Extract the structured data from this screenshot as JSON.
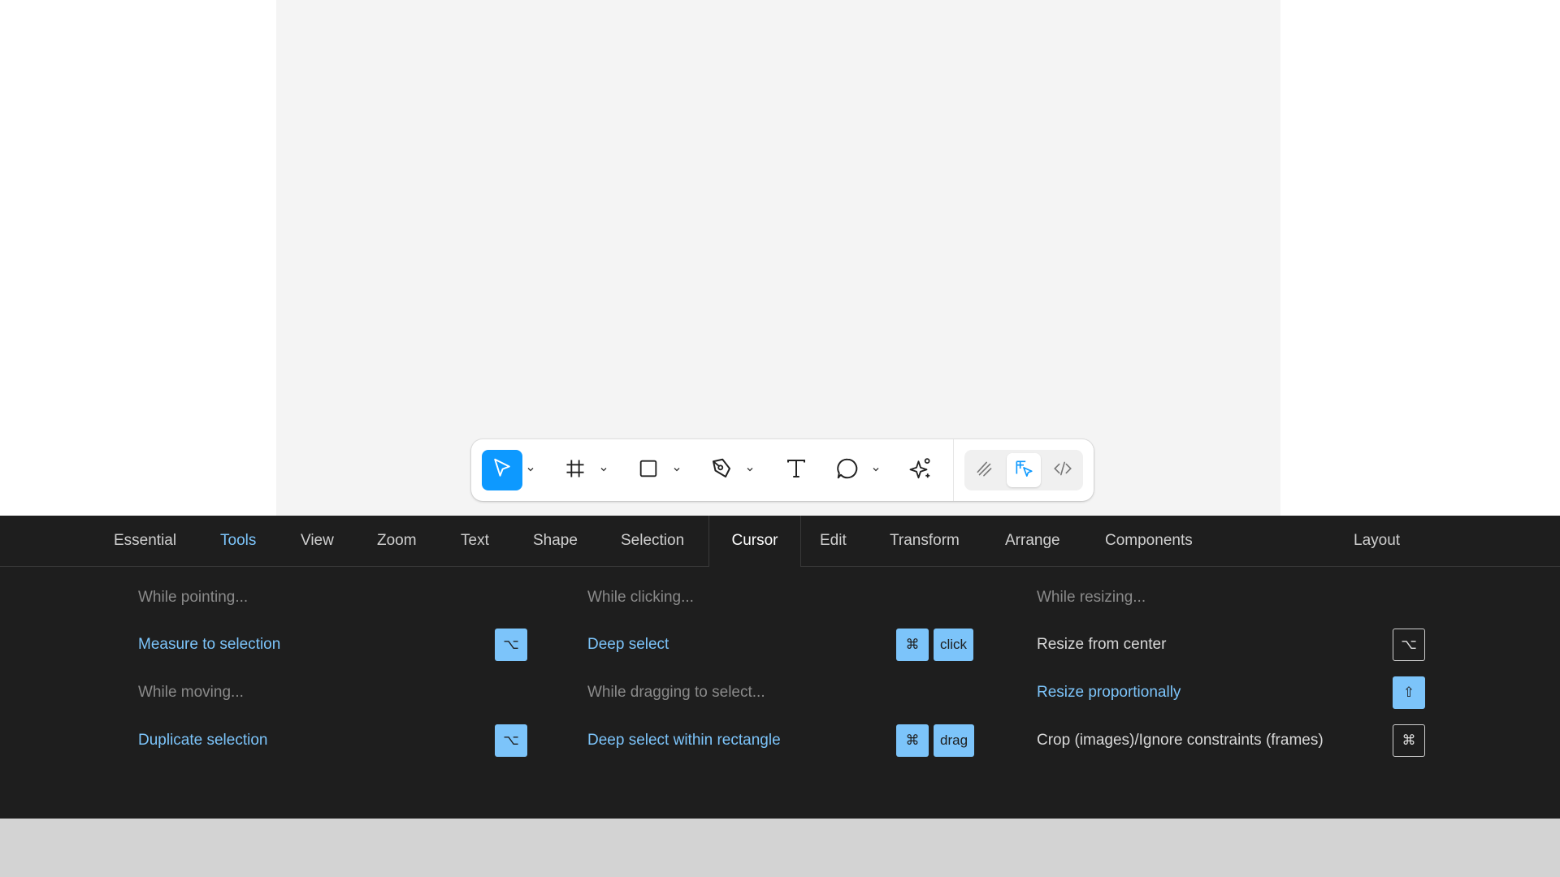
{
  "toolbar": {
    "tools": [
      {
        "name": "move-tool",
        "icon": "pointer-icon",
        "active": true
      },
      {
        "name": "frame-tool",
        "icon": "hash-frame-icon"
      },
      {
        "name": "rectangle-tool",
        "icon": "square-icon"
      },
      {
        "name": "pen-tool",
        "icon": "pen-icon"
      },
      {
        "name": "text-tool",
        "icon": "text-t-icon"
      },
      {
        "name": "comment-tool",
        "icon": "speech-bubble-icon"
      },
      {
        "name": "actions-tool",
        "icon": "sparkle-icon"
      }
    ],
    "modes": [
      {
        "name": "draw-mode",
        "icon": "scribble-icon"
      },
      {
        "name": "design-mode",
        "icon": "design-cursor-icon",
        "active": true
      },
      {
        "name": "dev-mode",
        "icon": "code-brackets-icon"
      }
    ],
    "accent_color": "#0d99ff"
  },
  "tabs": {
    "items": [
      "Essential",
      "Tools",
      "View",
      "Zoom",
      "Text",
      "Shape",
      "Selection",
      "Cursor",
      "Edit",
      "Transform",
      "Arrange",
      "Components"
    ],
    "layout_label": "Layout",
    "highlighted": "Tools",
    "current": "Cursor"
  },
  "columns": [
    {
      "rows": [
        {
          "type": "heading",
          "text": "While pointing..."
        },
        {
          "type": "item",
          "text": "Measure to selection",
          "highlight": true,
          "keys": [
            {
              "label": "⌥",
              "style": "filled"
            }
          ]
        },
        {
          "type": "heading",
          "text": "While moving..."
        },
        {
          "type": "item",
          "text": "Duplicate selection",
          "highlight": true,
          "keys": [
            {
              "label": "⌥",
              "style": "filled"
            }
          ]
        }
      ]
    },
    {
      "rows": [
        {
          "type": "heading",
          "text": "While clicking..."
        },
        {
          "type": "item",
          "text": "Deep select",
          "highlight": true,
          "keys": [
            {
              "label": "⌘",
              "style": "filled"
            },
            {
              "label": "click",
              "style": "filled"
            }
          ]
        },
        {
          "type": "heading",
          "text": "While dragging to select..."
        },
        {
          "type": "item",
          "text": "Deep select within rectangle",
          "highlight": true,
          "keys": [
            {
              "label": "⌘",
              "style": "filled"
            },
            {
              "label": "drag",
              "style": "filled"
            }
          ]
        }
      ]
    },
    {
      "rows": [
        {
          "type": "heading",
          "text": "While resizing..."
        },
        {
          "type": "item",
          "text": "Resize from center",
          "highlight": false,
          "keys": [
            {
              "label": "⌥",
              "style": "outline"
            }
          ]
        },
        {
          "type": "item",
          "text": "Resize proportionally",
          "highlight": true,
          "keys": [
            {
              "label": "⇧",
              "style": "filled"
            }
          ]
        },
        {
          "type": "item",
          "text": "Crop (images)/Ignore constraints (frames)",
          "highlight": false,
          "keys": [
            {
              "label": "⌘",
              "style": "outline"
            }
          ]
        }
      ]
    }
  ],
  "colors": {
    "panel_bg": "#1e1e1e",
    "highlight_text": "#7cc4fa",
    "key_fill": "#7cc4fa",
    "canvas_frame": "#f4f4f4",
    "bottom_strip": "#d3d3d3"
  }
}
